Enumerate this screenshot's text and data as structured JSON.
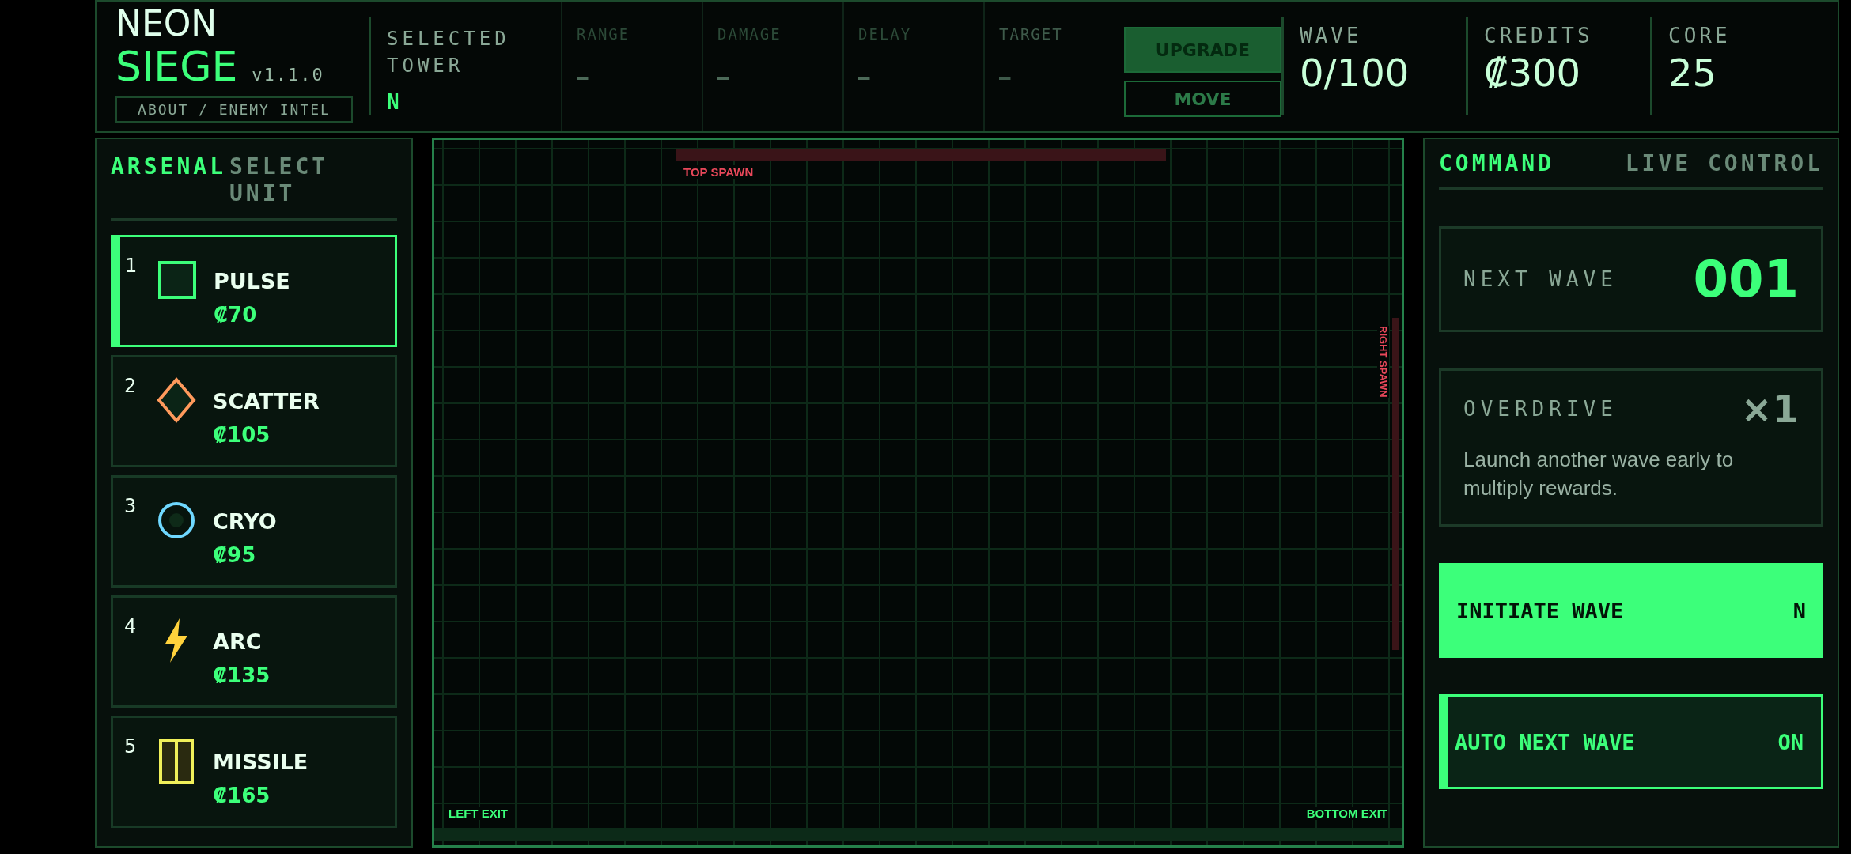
{
  "title": {
    "line_1": "NEON",
    "line_2": "SIEGE",
    "version": "v1.1.0",
    "about_button": "ABOUT / ENEMY INTEL"
  },
  "selected_tower": {
    "label": "SELECTED TOWER",
    "name": "N"
  },
  "tower_stats": [
    {
      "label": "RANGE",
      "value": "—"
    },
    {
      "label": "DAMAGE",
      "value": "—"
    },
    {
      "label": "DELAY",
      "value": "—"
    },
    {
      "label": "TARGET",
      "value": "—"
    }
  ],
  "tower_actions": [
    {
      "label": "UPGRADE",
      "kind": "primary"
    },
    {
      "label": "MOVE",
      "kind": "outline"
    }
  ],
  "status": [
    {
      "label": "WAVE",
      "value": "0/100"
    },
    {
      "label": "CREDITS",
      "value": "₡300"
    },
    {
      "label": "CORE",
      "value": "25"
    }
  ],
  "arsenal": {
    "title": "ARSENAL",
    "subtitle": "SELECT UNIT",
    "units": [
      {
        "key": "1",
        "name": "PULSE",
        "cost": "₡70",
        "kind": "square",
        "color": "#3cff7a",
        "selected": true
      },
      {
        "key": "2",
        "name": "SCATTER",
        "cost": "₡105",
        "kind": "diamond",
        "color": "#ff9a5c",
        "selected": false
      },
      {
        "key": "3",
        "name": "CRYO",
        "cost": "₡95",
        "kind": "circle",
        "color": "#6fd8ff",
        "selected": false
      },
      {
        "key": "4",
        "name": "ARC",
        "cost": "₡135",
        "kind": "bolt",
        "color": "#ffd23c",
        "selected": false
      },
      {
        "key": "5",
        "name": "MISSILE",
        "cost": "₡165",
        "kind": "pods",
        "color": "#f0f05a",
        "selected": false
      }
    ]
  },
  "map": {
    "top_spawn": "TOP SPAWN",
    "right_spawn": "RIGHT SPAWN",
    "left_exit": "LEFT EXIT",
    "bottom_exit": "BOTTOM EXIT"
  },
  "command": {
    "title": "COMMAND",
    "subtitle": "LIVE CONTROL",
    "next_wave": {
      "label": "NEXT WAVE",
      "value": "001"
    },
    "overdrive": {
      "label": "OVERDRIVE",
      "multiplier": "×1",
      "description": "Launch another wave early to multiply rewards."
    },
    "initiate": {
      "label": "INITIATE WAVE",
      "key": "N"
    },
    "auto_next": {
      "label": "AUTO NEXT WAVE",
      "value": "ON",
      "on": true
    }
  }
}
